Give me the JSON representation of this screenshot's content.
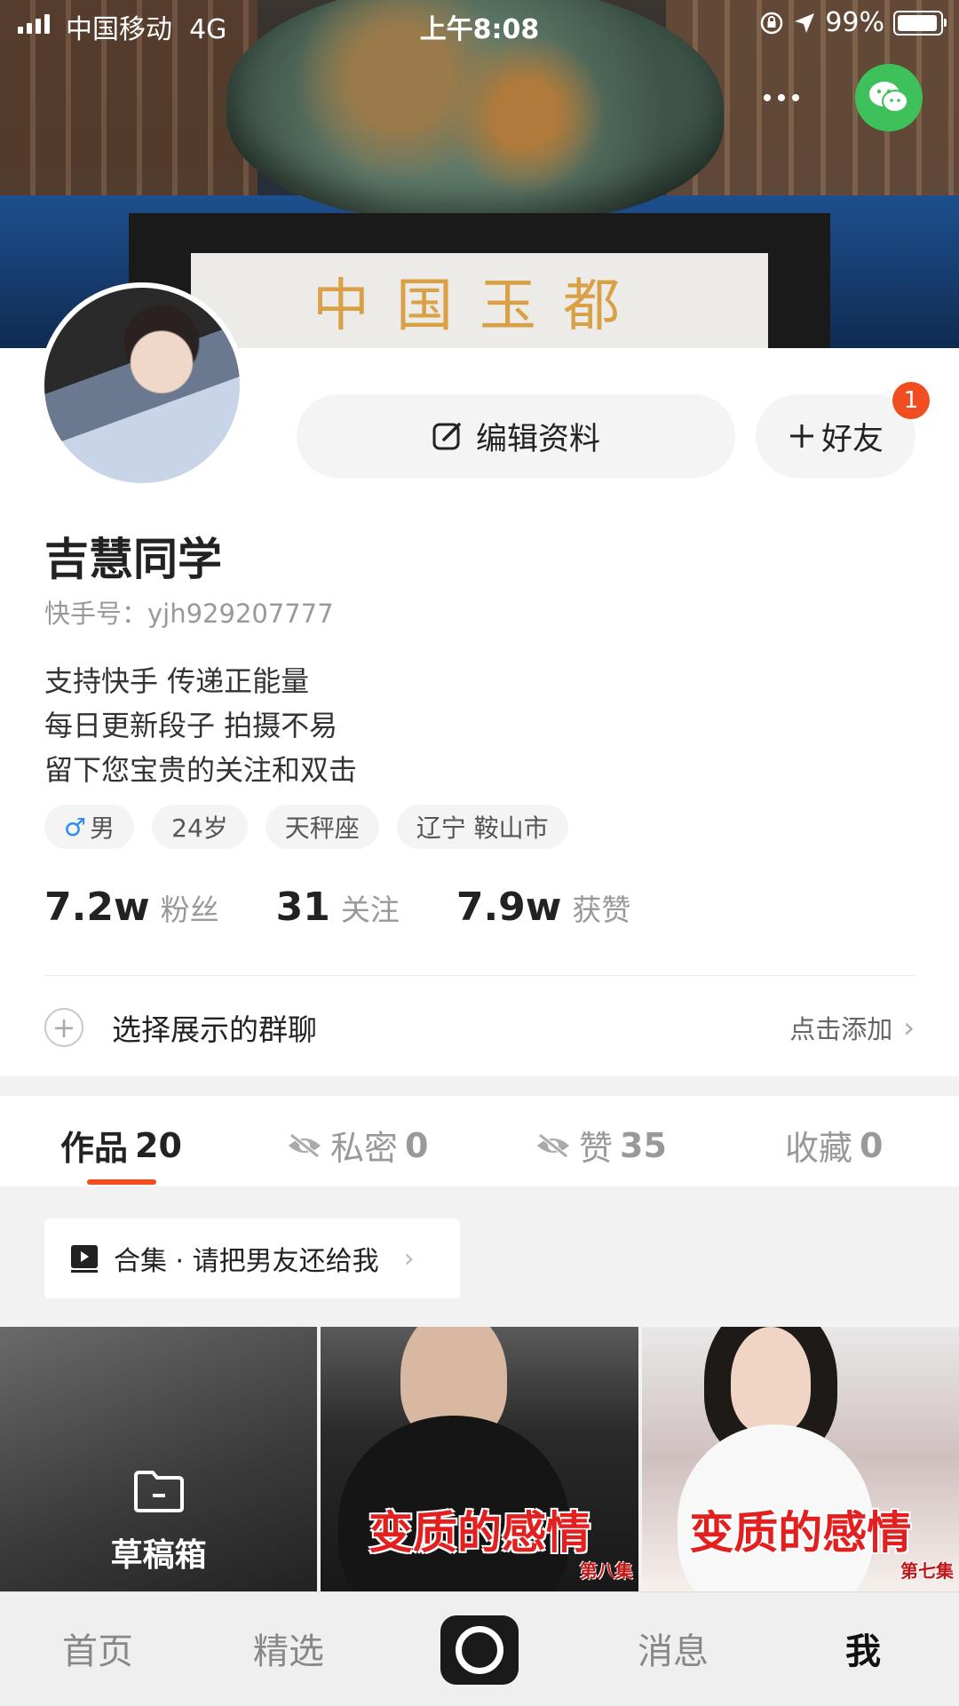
{
  "status_bar": {
    "carrier": "中国移动",
    "network": "4G",
    "time": "上午8:08",
    "battery": "99%"
  },
  "banner": {
    "plaque_text": "中国玉都"
  },
  "profile": {
    "edit_label": "编辑资料",
    "friend_label": "好友",
    "friend_badge": "1",
    "name": "吉慧同学",
    "kuaishou_id": "快手号：yjh929207777",
    "bio": [
      "支持快手 传递正能量",
      "每日更新段子 拍摄不易",
      "留下您宝贵的关注和双击"
    ],
    "tags": {
      "gender_symbol": "♂",
      "gender": "男",
      "age": "24岁",
      "zodiac": "天秤座",
      "location": "辽宁 鞍山市"
    },
    "stats": [
      {
        "num": "7.2w",
        "label": "粉丝"
      },
      {
        "num": "31",
        "label": "关注"
      },
      {
        "num": "7.9w",
        "label": "获赞"
      }
    ],
    "group_row": {
      "title": "选择展示的群聊",
      "action": "点击添加"
    }
  },
  "tabs": [
    {
      "label": "作品",
      "count": "20"
    },
    {
      "label": "私密",
      "count": "0"
    },
    {
      "label": "赞",
      "count": "35"
    },
    {
      "label": "收藏",
      "count": "0"
    }
  ],
  "collection": {
    "label": "合集 · 请把男友还给我"
  },
  "grid": {
    "draft_label": "草稿箱",
    "videos": [
      {
        "title": "变质的感情",
        "episode": "第八集"
      },
      {
        "title": "变质的感情",
        "episode": "第七集"
      }
    ]
  },
  "bottom_nav": {
    "home": "首页",
    "featured": "精选",
    "messages": "消息",
    "me": "我"
  },
  "colors": {
    "accent": "#f04e20",
    "wechat": "#3ec15a",
    "male": "#2f8bf0"
  },
  "icons": [
    "signal-icon",
    "lock-rotation-icon",
    "location-arrow-icon",
    "battery-icon",
    "more-icon",
    "wechat-icon",
    "edit-icon",
    "plus-icon",
    "eye-off-icon",
    "play-square-icon",
    "folder-icon",
    "chevron-right-icon",
    "camera-icon"
  ]
}
